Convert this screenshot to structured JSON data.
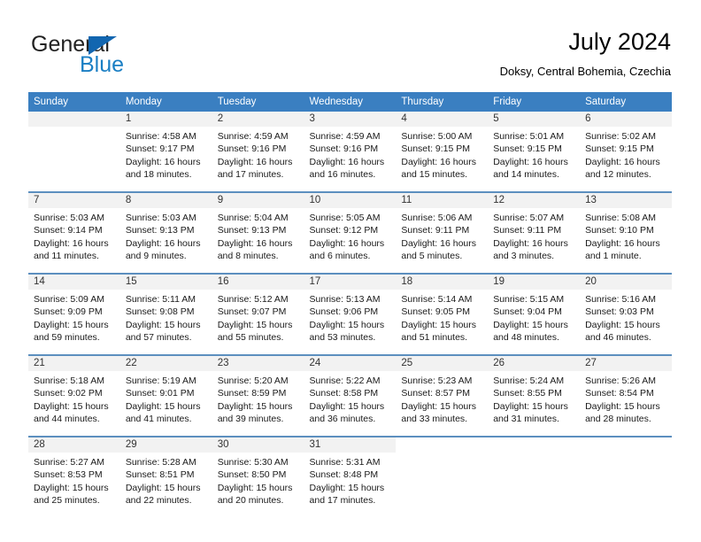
{
  "brand": {
    "name_top": "General",
    "name_bottom": "Blue",
    "accent_color": "#1266b0",
    "blue_text_color": "#1b7fc4"
  },
  "header": {
    "title": "July 2024",
    "subtitle": "Doksy, Central Bohemia, Czechia"
  },
  "theme": {
    "header_row_bg": "#3a7fc1",
    "day_band_bg": "#f2f2f2",
    "row_divider": "#5c8fbf"
  },
  "weekday_headers": [
    "Sunday",
    "Monday",
    "Tuesday",
    "Wednesday",
    "Thursday",
    "Friday",
    "Saturday"
  ],
  "weeks": [
    [
      {
        "day": "",
        "sunrise": "",
        "sunset": "",
        "daylight_1": "",
        "daylight_2": "",
        "empty": true
      },
      {
        "day": "1",
        "sunrise": "Sunrise: 4:58 AM",
        "sunset": "Sunset: 9:17 PM",
        "daylight_1": "Daylight: 16 hours",
        "daylight_2": "and 18 minutes."
      },
      {
        "day": "2",
        "sunrise": "Sunrise: 4:59 AM",
        "sunset": "Sunset: 9:16 PM",
        "daylight_1": "Daylight: 16 hours",
        "daylight_2": "and 17 minutes."
      },
      {
        "day": "3",
        "sunrise": "Sunrise: 4:59 AM",
        "sunset": "Sunset: 9:16 PM",
        "daylight_1": "Daylight: 16 hours",
        "daylight_2": "and 16 minutes."
      },
      {
        "day": "4",
        "sunrise": "Sunrise: 5:00 AM",
        "sunset": "Sunset: 9:15 PM",
        "daylight_1": "Daylight: 16 hours",
        "daylight_2": "and 15 minutes."
      },
      {
        "day": "5",
        "sunrise": "Sunrise: 5:01 AM",
        "sunset": "Sunset: 9:15 PM",
        "daylight_1": "Daylight: 16 hours",
        "daylight_2": "and 14 minutes."
      },
      {
        "day": "6",
        "sunrise": "Sunrise: 5:02 AM",
        "sunset": "Sunset: 9:15 PM",
        "daylight_1": "Daylight: 16 hours",
        "daylight_2": "and 12 minutes."
      }
    ],
    [
      {
        "day": "7",
        "sunrise": "Sunrise: 5:03 AM",
        "sunset": "Sunset: 9:14 PM",
        "daylight_1": "Daylight: 16 hours",
        "daylight_2": "and 11 minutes."
      },
      {
        "day": "8",
        "sunrise": "Sunrise: 5:03 AM",
        "sunset": "Sunset: 9:13 PM",
        "daylight_1": "Daylight: 16 hours",
        "daylight_2": "and 9 minutes."
      },
      {
        "day": "9",
        "sunrise": "Sunrise: 5:04 AM",
        "sunset": "Sunset: 9:13 PM",
        "daylight_1": "Daylight: 16 hours",
        "daylight_2": "and 8 minutes."
      },
      {
        "day": "10",
        "sunrise": "Sunrise: 5:05 AM",
        "sunset": "Sunset: 9:12 PM",
        "daylight_1": "Daylight: 16 hours",
        "daylight_2": "and 6 minutes."
      },
      {
        "day": "11",
        "sunrise": "Sunrise: 5:06 AM",
        "sunset": "Sunset: 9:11 PM",
        "daylight_1": "Daylight: 16 hours",
        "daylight_2": "and 5 minutes."
      },
      {
        "day": "12",
        "sunrise": "Sunrise: 5:07 AM",
        "sunset": "Sunset: 9:11 PM",
        "daylight_1": "Daylight: 16 hours",
        "daylight_2": "and 3 minutes."
      },
      {
        "day": "13",
        "sunrise": "Sunrise: 5:08 AM",
        "sunset": "Sunset: 9:10 PM",
        "daylight_1": "Daylight: 16 hours",
        "daylight_2": "and 1 minute."
      }
    ],
    [
      {
        "day": "14",
        "sunrise": "Sunrise: 5:09 AM",
        "sunset": "Sunset: 9:09 PM",
        "daylight_1": "Daylight: 15 hours",
        "daylight_2": "and 59 minutes."
      },
      {
        "day": "15",
        "sunrise": "Sunrise: 5:11 AM",
        "sunset": "Sunset: 9:08 PM",
        "daylight_1": "Daylight: 15 hours",
        "daylight_2": "and 57 minutes."
      },
      {
        "day": "16",
        "sunrise": "Sunrise: 5:12 AM",
        "sunset": "Sunset: 9:07 PM",
        "daylight_1": "Daylight: 15 hours",
        "daylight_2": "and 55 minutes."
      },
      {
        "day": "17",
        "sunrise": "Sunrise: 5:13 AM",
        "sunset": "Sunset: 9:06 PM",
        "daylight_1": "Daylight: 15 hours",
        "daylight_2": "and 53 minutes."
      },
      {
        "day": "18",
        "sunrise": "Sunrise: 5:14 AM",
        "sunset": "Sunset: 9:05 PM",
        "daylight_1": "Daylight: 15 hours",
        "daylight_2": "and 51 minutes."
      },
      {
        "day": "19",
        "sunrise": "Sunrise: 5:15 AM",
        "sunset": "Sunset: 9:04 PM",
        "daylight_1": "Daylight: 15 hours",
        "daylight_2": "and 48 minutes."
      },
      {
        "day": "20",
        "sunrise": "Sunrise: 5:16 AM",
        "sunset": "Sunset: 9:03 PM",
        "daylight_1": "Daylight: 15 hours",
        "daylight_2": "and 46 minutes."
      }
    ],
    [
      {
        "day": "21",
        "sunrise": "Sunrise: 5:18 AM",
        "sunset": "Sunset: 9:02 PM",
        "daylight_1": "Daylight: 15 hours",
        "daylight_2": "and 44 minutes."
      },
      {
        "day": "22",
        "sunrise": "Sunrise: 5:19 AM",
        "sunset": "Sunset: 9:01 PM",
        "daylight_1": "Daylight: 15 hours",
        "daylight_2": "and 41 minutes."
      },
      {
        "day": "23",
        "sunrise": "Sunrise: 5:20 AM",
        "sunset": "Sunset: 8:59 PM",
        "daylight_1": "Daylight: 15 hours",
        "daylight_2": "and 39 minutes."
      },
      {
        "day": "24",
        "sunrise": "Sunrise: 5:22 AM",
        "sunset": "Sunset: 8:58 PM",
        "daylight_1": "Daylight: 15 hours",
        "daylight_2": "and 36 minutes."
      },
      {
        "day": "25",
        "sunrise": "Sunrise: 5:23 AM",
        "sunset": "Sunset: 8:57 PM",
        "daylight_1": "Daylight: 15 hours",
        "daylight_2": "and 33 minutes."
      },
      {
        "day": "26",
        "sunrise": "Sunrise: 5:24 AM",
        "sunset": "Sunset: 8:55 PM",
        "daylight_1": "Daylight: 15 hours",
        "daylight_2": "and 31 minutes."
      },
      {
        "day": "27",
        "sunrise": "Sunrise: 5:26 AM",
        "sunset": "Sunset: 8:54 PM",
        "daylight_1": "Daylight: 15 hours",
        "daylight_2": "and 28 minutes."
      }
    ],
    [
      {
        "day": "28",
        "sunrise": "Sunrise: 5:27 AM",
        "sunset": "Sunset: 8:53 PM",
        "daylight_1": "Daylight: 15 hours",
        "daylight_2": "and 25 minutes."
      },
      {
        "day": "29",
        "sunrise": "Sunrise: 5:28 AM",
        "sunset": "Sunset: 8:51 PM",
        "daylight_1": "Daylight: 15 hours",
        "daylight_2": "and 22 minutes."
      },
      {
        "day": "30",
        "sunrise": "Sunrise: 5:30 AM",
        "sunset": "Sunset: 8:50 PM",
        "daylight_1": "Daylight: 15 hours",
        "daylight_2": "and 20 minutes."
      },
      {
        "day": "31",
        "sunrise": "Sunrise: 5:31 AM",
        "sunset": "Sunset: 8:48 PM",
        "daylight_1": "Daylight: 15 hours",
        "daylight_2": "and 17 minutes."
      },
      {
        "day": "",
        "sunrise": "",
        "sunset": "",
        "daylight_1": "",
        "daylight_2": "",
        "blank": true
      },
      {
        "day": "",
        "sunrise": "",
        "sunset": "",
        "daylight_1": "",
        "daylight_2": "",
        "blank": true
      },
      {
        "day": "",
        "sunrise": "",
        "sunset": "",
        "daylight_1": "",
        "daylight_2": "",
        "blank": true
      }
    ]
  ]
}
